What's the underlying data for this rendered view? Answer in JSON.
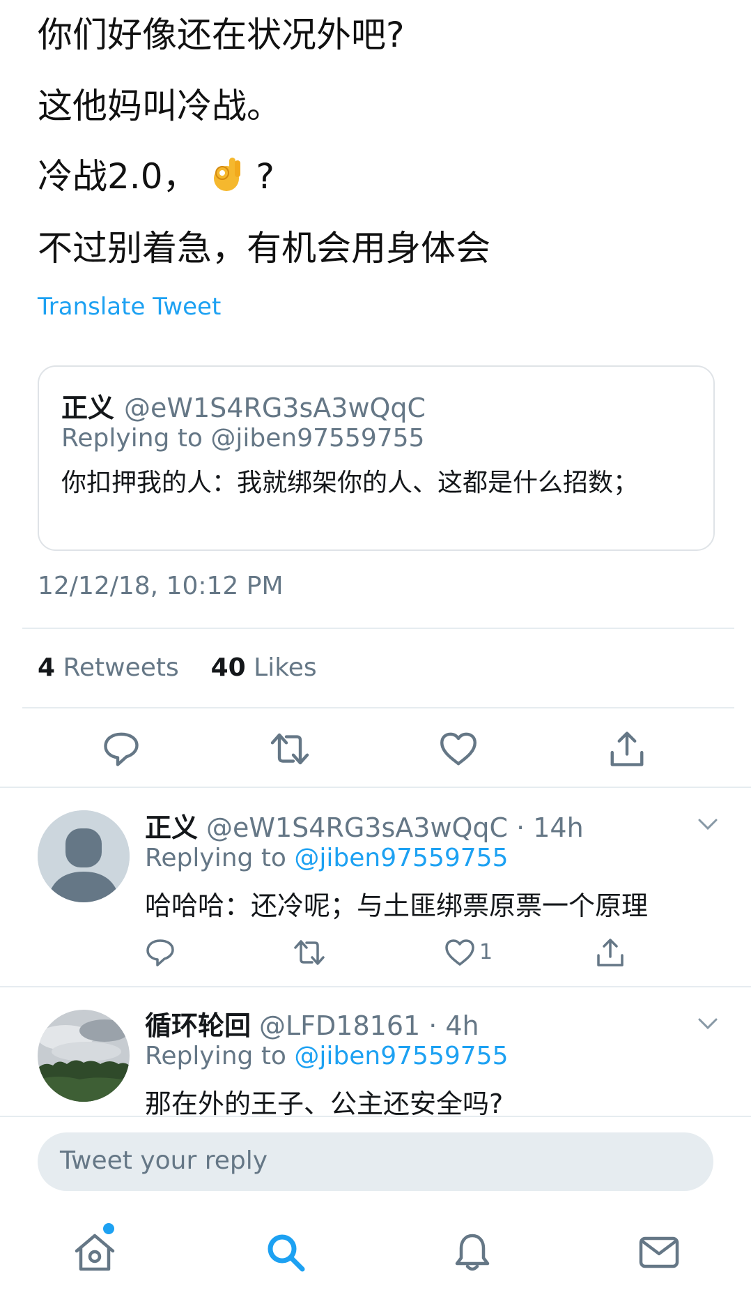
{
  "tweet": {
    "lines": [
      "你们好像还在状况外吧?",
      "这他妈叫冷战。",
      "冷战2.0，",
      "不过别着急，有机会用身体会"
    ],
    "line3_suffix": "?",
    "emoji": "ok-hand-emoji",
    "translate_label": "Translate Tweet"
  },
  "quote": {
    "name": "正义",
    "handle": "@eW1S4RG3sA3wQqC",
    "replying_to": "Replying to @jiben97559755",
    "text": "你扣押我的人：我就绑架你的人、这都是什么招数；"
  },
  "timestamp": "12/12/18, 10:12 PM",
  "stats": {
    "retweets_count": "4",
    "retweets_label": "Retweets",
    "likes_count": "40",
    "likes_label": "Likes"
  },
  "replies": [
    {
      "name": "正义",
      "handle": "@eW1S4RG3sA3wQqC",
      "time": "· 14h",
      "replying_prefix": "Replying to",
      "replying_handle": "@jiben97559755",
      "text": "哈哈哈：还冷呢；与土匪绑票原票一个原理",
      "like_count": "1"
    },
    {
      "name": "循环轮回",
      "handle": "@LFD18161",
      "time": "· 4h",
      "replying_prefix": "Replying to",
      "replying_handle": "@jiben97559755",
      "text": "那在外的王子、公主还安全吗?"
    }
  ],
  "reply_bar": {
    "placeholder": "Tweet your reply"
  },
  "colors": {
    "accent": "#1da1f2",
    "muted": "#657786",
    "divider": "#e6ecf0",
    "text": "#14171a"
  },
  "icons": [
    "reply-icon",
    "retweet-icon",
    "like-icon",
    "share-icon",
    "chevron-down-icon",
    "home-icon",
    "search-icon",
    "bell-icon",
    "mail-icon"
  ]
}
